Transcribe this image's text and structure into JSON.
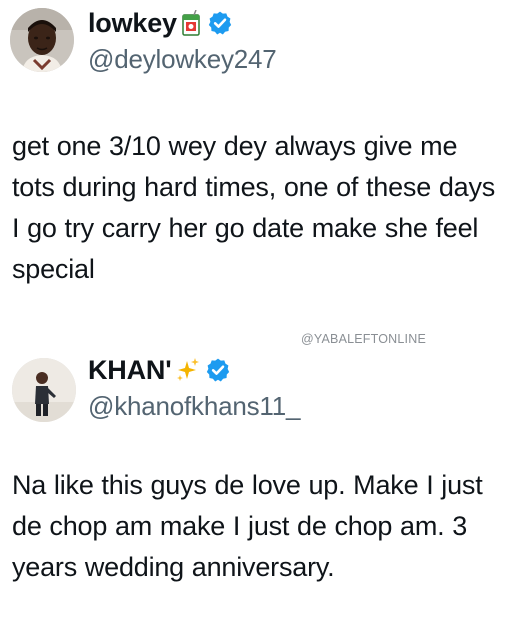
{
  "watermark": "@YABALEFTONLINE",
  "tweets": [
    {
      "display_name": "lowkey",
      "name_emoji_icon": "juice-box-emoji-icon",
      "verified_icon": "verified-badge-icon",
      "handle": "@deylowkey247",
      "text": "get one 3/10 wey dey always give me tots during hard times, one of these days I go try carry her go date make she feel special"
    },
    {
      "display_name": "KHAN'",
      "name_emoji_icon": "sparkles-emoji-icon",
      "verified_icon": "verified-badge-icon",
      "handle": "@khanofkhans11_",
      "text": "Na like this guys de love up. Make I just de chop am make I just de chop am. 3 years wedding anniversary."
    }
  ],
  "colors": {
    "text": "#0f1419",
    "handle": "#536471",
    "verified": "#1d9bf0",
    "watermark": "#8a8f94"
  }
}
